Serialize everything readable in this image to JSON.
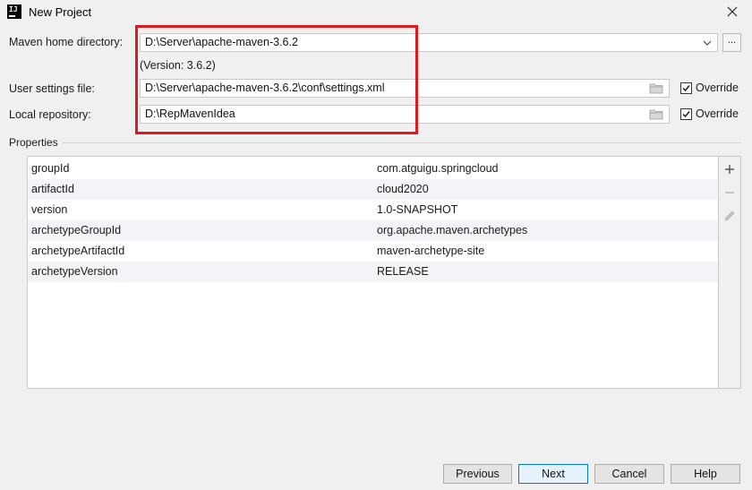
{
  "window": {
    "title": "New Project",
    "icon_name": "intellij-idea-icon"
  },
  "maven_home": {
    "label": "Maven home directory:",
    "value": "D:\\Server\\apache-maven-3.6.2",
    "version": "(Version: 3.6.2)",
    "browse_label": "..."
  },
  "user_settings": {
    "label": "User settings file:",
    "value": "D:\\Server\\apache-maven-3.6.2\\conf\\settings.xml",
    "override_label": "Override",
    "override_checked": true
  },
  "local_repo": {
    "label": "Local repository:",
    "value": "D:\\RepMavenIdea",
    "override_label": "Override",
    "override_checked": true
  },
  "properties": {
    "section_label": "Properties",
    "rows": [
      {
        "key": "groupId",
        "value": "com.atguigu.springcloud"
      },
      {
        "key": "artifactId",
        "value": "cloud2020"
      },
      {
        "key": "version",
        "value": "1.0-SNAPSHOT"
      },
      {
        "key": "archetypeGroupId",
        "value": "org.apache.maven.archetypes"
      },
      {
        "key": "archetypeArtifactId",
        "value": "maven-archetype-site"
      },
      {
        "key": "archetypeVersion",
        "value": "RELEASE"
      }
    ]
  },
  "footer": {
    "previous_label": "Previous",
    "next_label": "Next",
    "cancel_label": "Cancel",
    "help_label": "Help"
  },
  "colors": {
    "highlight": "#e0191e",
    "default_button_border": "#0078d7",
    "alt_row": "#f2f4f7"
  }
}
